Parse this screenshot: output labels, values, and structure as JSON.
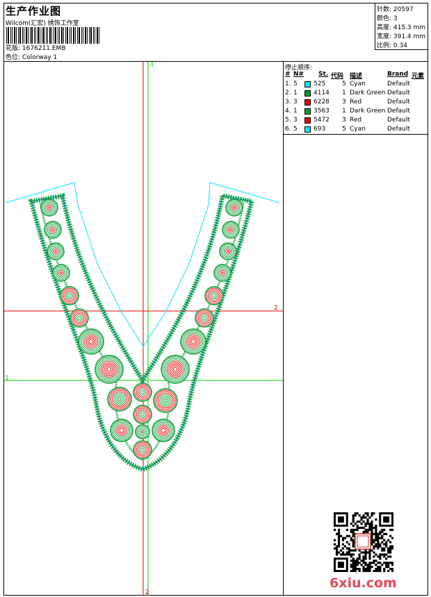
{
  "header": {
    "title": "生产作业图",
    "subtitle": "Wilcom(汇宏) 绣饰工作室",
    "design_file_label": "花版:",
    "design_file": "1676211.EMB",
    "colorway_label": "色位:",
    "colorway": "Colorway 1"
  },
  "stats": {
    "stitches": "针数: 20597",
    "colors": "颜色: 3",
    "height": "高度: 415.3 mm",
    "width": "宽度: 391.4 mm",
    "scale": "比例: 0.34"
  },
  "stop_sequence": {
    "title": "停止顺序:",
    "headers": {
      "num": "#",
      "needle": "N#",
      "stitches": "St.",
      "code": "代码",
      "desc": "描述",
      "brand": "Brand",
      "element": "元素"
    },
    "rows": [
      {
        "num": "1.",
        "needle": "5",
        "color": "#00e5ff",
        "stitches": "525",
        "code": "5",
        "desc": "Cyan",
        "brand": "Default"
      },
      {
        "num": "2.",
        "needle": "1",
        "color": "#009a2e",
        "stitches": "4114",
        "code": "1",
        "desc": "Dark Green",
        "brand": "Default"
      },
      {
        "num": "3.",
        "needle": "3",
        "color": "#e60000",
        "stitches": "6228",
        "code": "3",
        "desc": "Red",
        "brand": "Default"
      },
      {
        "num": "4.",
        "needle": "1",
        "color": "#009a2e",
        "stitches": "3563",
        "code": "1",
        "desc": "Dark Green",
        "brand": "Default"
      },
      {
        "num": "5.",
        "needle": "3",
        "color": "#e60000",
        "stitches": "5472",
        "code": "3",
        "desc": "Red",
        "brand": "Default"
      },
      {
        "num": "6.",
        "needle": "5",
        "color": "#00e5ff",
        "stitches": "693",
        "code": "5",
        "desc": "Cyan",
        "brand": "Default"
      }
    ]
  },
  "guides": {
    "vertical_red_label": "2",
    "vertical_green_label": "1",
    "horizontal_red_label": "2",
    "horizontal_green_label": "1",
    "vertical_red_bottom_label": "2"
  },
  "watermark": "6xiu.com",
  "colors": {
    "cyan": "#00e5ff",
    "green": "#009a2e",
    "red": "#e60000",
    "guide_red": "#e00000",
    "guide_green": "#00d000"
  }
}
